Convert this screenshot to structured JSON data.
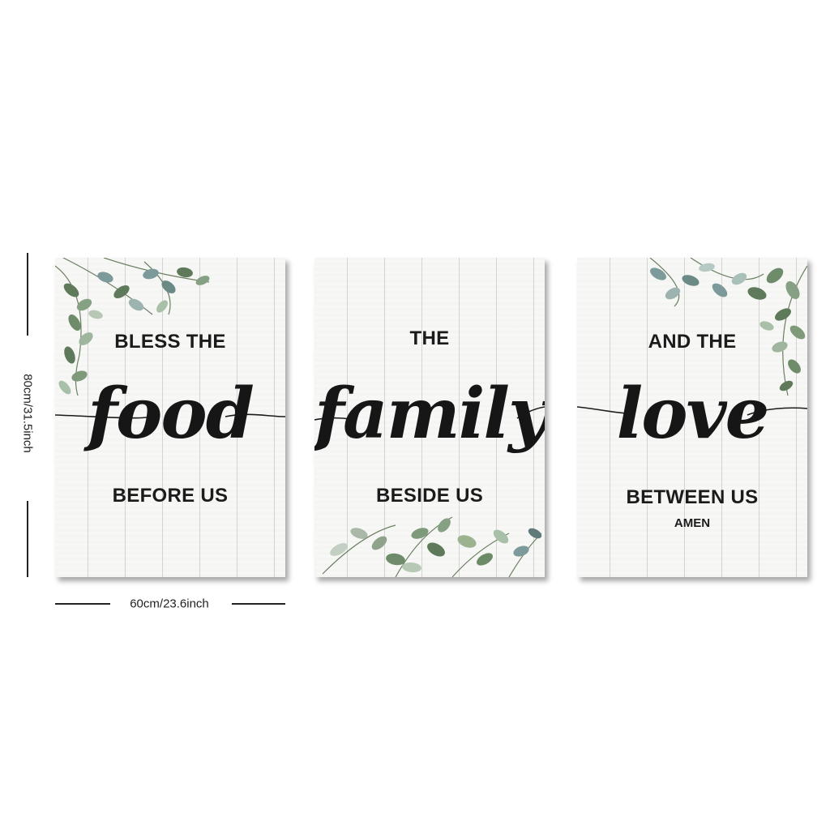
{
  "dimensions": {
    "height_label": "80cm/31.5inch",
    "width_label": "60cm/23.6inch"
  },
  "panels": [
    {
      "top_line": "BLESS THE",
      "script_word": "food",
      "bottom_line": "BEFORE US",
      "extra_line": ""
    },
    {
      "top_line": "THE",
      "script_word": "family",
      "bottom_line": "BESIDE US",
      "extra_line": ""
    },
    {
      "top_line": "AND THE",
      "script_word": "love",
      "bottom_line": "BETWEEN US",
      "extra_line": "AMEN"
    }
  ],
  "colors": {
    "text": "#1b1b1b",
    "wood_background": "#f7f7f5",
    "leaf_dark": "#5f7a5a",
    "leaf_light": "#a9c0a8",
    "leaf_blue": "#7d9a9a"
  },
  "icons": [
    "eucalyptus-leaves-icon",
    "swash-line-icon"
  ]
}
